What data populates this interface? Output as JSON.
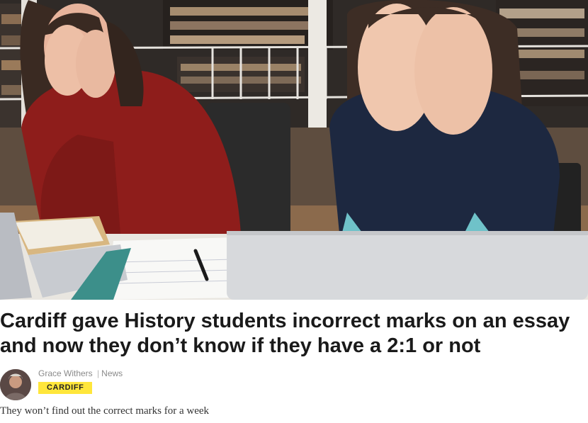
{
  "article": {
    "headline": "Cardiff gave History students incorrect marks on an essay and now they don’t know if they have a 2:1 or not",
    "author": "Grace Withers",
    "section": "News",
    "separator": "|",
    "tag": "CARDIFF",
    "standfirst": "They won’t find out the correct marks for a week"
  },
  "hero_image": {
    "subject": "two students in a library covering their faces with their hands, laptops on the desk"
  },
  "colors": {
    "badge_bg": "#ffe63b",
    "headline_text": "#1a1a1a",
    "meta_text": "#8a8a8a"
  }
}
